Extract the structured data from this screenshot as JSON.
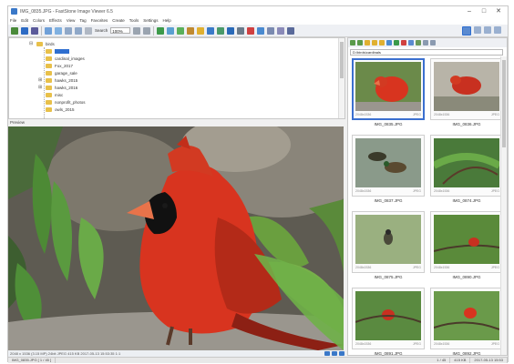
{
  "window": {
    "title": "IMG_0835.JPG - FastStone Image Viewer 6.5",
    "controls": [
      "–",
      "□",
      "✕"
    ]
  },
  "menu": [
    "File",
    "Edit",
    "Colors",
    "Effects",
    "View",
    "Tag",
    "Favorites",
    "Create",
    "Tools",
    "Settings",
    "Help"
  ],
  "toolbar": {
    "search_label": "Search",
    "zoom_value": "100%"
  },
  "folders": {
    "items": [
      {
        "label": "birds",
        "selected": false
      },
      {
        "label": "",
        "selected": true
      },
      {
        "label": "cardinal_images",
        "selected": false
      },
      {
        "label": "Fox_2017",
        "selected": false
      },
      {
        "label": "garage_sale",
        "selected": false
      },
      {
        "label": "hawks_2015",
        "selected": false
      },
      {
        "label": "hawks_2016",
        "selected": false
      },
      {
        "label": "misc",
        "selected": false
      },
      {
        "label": "nonprofit_photos",
        "selected": false
      },
      {
        "label": "owls_2015",
        "selected": false
      }
    ]
  },
  "preview": {
    "label": "Preview",
    "status_text": "2048 x 1536 (3.15 MP)  24bit  JPEG  415 KB  2017-05-13 15:53:35  1:1"
  },
  "browser": {
    "path": "D:\\birds\\cardinals",
    "thumbnails": [
      {
        "name": "IMG_0835.JPG",
        "dims": "2048x1536",
        "type": "JPEG"
      },
      {
        "name": "IMG_0836.JPG",
        "dims": "2048x1536",
        "type": "JPEG"
      },
      {
        "name": "IMG_0837.JPG",
        "dims": "2048x1536",
        "type": "JPEG"
      },
      {
        "name": "IMG_0874.JPG",
        "dims": "2048x1536",
        "type": "JPEG"
      },
      {
        "name": "IMG_0875.JPG",
        "dims": "2048x1536",
        "type": "JPEG"
      },
      {
        "name": "IMG_0890.JPG",
        "dims": "2048x1536",
        "type": "JPEG"
      },
      {
        "name": "IMG_0891.JPG",
        "dims": "2048x1536",
        "type": "JPEG"
      },
      {
        "name": "IMG_0892.JPG",
        "dims": "2048x1536",
        "type": "JPEG"
      }
    ]
  },
  "statusbar": {
    "left": "IMG_0835.JPG [ 1 / 45 ]",
    "middle": "1 / 45",
    "size": "415 KB",
    "date": "2017-05-13 15:53"
  },
  "colors": {
    "selection": "#3b6fcf",
    "folder": "#e8c04a",
    "cardinal_red": "#d8341f"
  }
}
